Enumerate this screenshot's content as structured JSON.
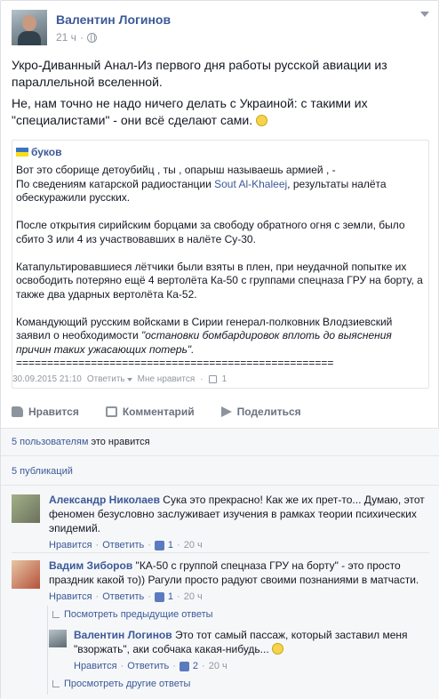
{
  "post": {
    "author": "Валентин Логинов",
    "time": "21 ч",
    "paragraph1": "Укро-Диванный Анал-Из первого дня работы русской авиации из параллельной вселенной.",
    "paragraph2": "Не, нам точно не надо ничего делать с Украиной: с такими их \"специалистами\" - они всё сделают сами."
  },
  "shared": {
    "author": "буков",
    "line1": "Вот это сборище детоубийц , ты , опарыш называешь армией , -",
    "line2_prefix": "По сведениям катарской радиостанции ",
    "line2_link": "Sout Al-Khaleej",
    "line2_suffix": ", результаты налёта обескуражили русских.",
    "para2": "После открытия сирийским борцами за свободу обратного огня с земли, было сбито 3 или 4 из участвовавших в налёте Су-30.",
    "para3": "Катапультировавшиеся лётчики были взяты в плен, при неудачной попытке их освободить потеряно ещё 4 вертолёта Ка-50 с группами спецназа ГРУ на борту, а также два ударных вертолёта Ка-52.",
    "para4_prefix": "Командующий русским войсками в Сирии генерал-полковник Влодзиевский заявил о необходимости ",
    "para4_quote": "\"остановки бомбардировок вплоть до выяснения причин таких ужасающих потерь\".",
    "separator": "===================================================",
    "date": "30.09.2015 21:10",
    "reply": "Ответить",
    "dislike": "Мне нравится",
    "like_count": "1"
  },
  "actions": {
    "like": "Нравится",
    "comment": "Комментарий",
    "share": "Поделиться"
  },
  "summary": {
    "likes_link": "5 пользователям",
    "likes_text": " это нравится",
    "shares": "5 публикаций"
  },
  "comments": [
    {
      "name": "Александр Николаев",
      "text": " Сука это прекрасно! Как же их прет-то... Думаю, этот феномен безусловно заслуживает изучения в рамках теории психических эпидемий.",
      "like": "Нравится",
      "reply": "Ответить",
      "likes": "1",
      "time": "20 ч"
    },
    {
      "name": "Вадим Зиборов",
      "text": " \"КА-50 с группой спецназа ГРУ на борту\" - это просто праздник какой то)) Рагули просто радуют своими познаниями в матчасти.",
      "like": "Нравится",
      "reply": "Ответить",
      "likes": "1",
      "time": "20 ч"
    }
  ],
  "prev_replies": "Посмотреть предыдущие ответы",
  "reply": {
    "name": "Валентин Логинов",
    "text": " Это тот самый пассаж, который заставил меня \"взоржать\", аки собчака какая-нибудь...",
    "like": "Нравится",
    "reply": "Ответить",
    "likes": "2",
    "time": "20 ч"
  },
  "other_replies": "Просмотреть другие ответы",
  "colors": {
    "brand": "#3b5998",
    "muted": "#9197a3",
    "panel": "#f6f7f9"
  }
}
